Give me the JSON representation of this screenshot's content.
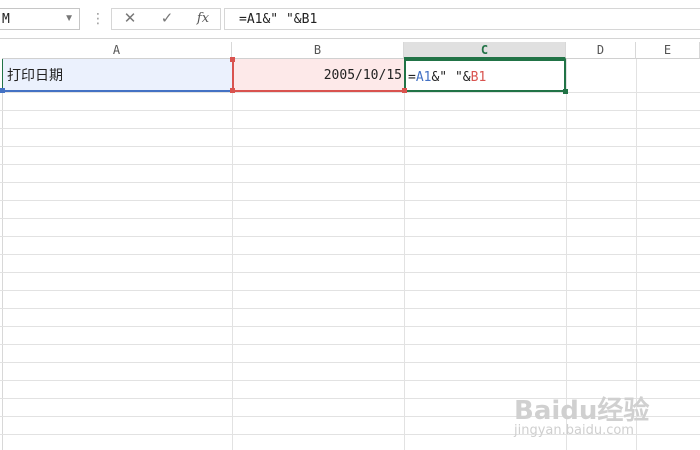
{
  "formula_bar": {
    "name_box": "M",
    "cancel_glyph": "✕",
    "enter_glyph": "✓",
    "fx_label": "fx",
    "formula": "=A1&\" \"&B1"
  },
  "columns": [
    {
      "label": "A"
    },
    {
      "label": "B"
    },
    {
      "label": "C"
    },
    {
      "label": "D"
    },
    {
      "label": "E"
    }
  ],
  "active_column": "C",
  "cells": {
    "a1": "打印日期",
    "b1": "2005/10/15",
    "c1": {
      "eq": "=",
      "ref_a": "A1",
      "mid": "&\" \"&",
      "ref_b": "B1"
    }
  },
  "colors": {
    "accent_green": "#217346",
    "ref_blue": "#4472c4",
    "ref_red": "#d9534f"
  },
  "watermark": {
    "logo": "Baidu经验",
    "url": "jingyan.baidu.com"
  }
}
